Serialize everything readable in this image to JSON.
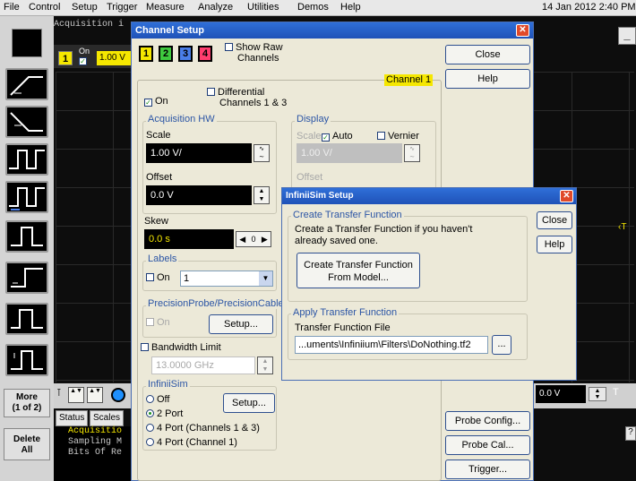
{
  "menubar": {
    "items": [
      "File",
      "Control",
      "Setup",
      "Trigger",
      "Measure",
      "Analyze",
      "Utilities",
      "Demos",
      "Help"
    ],
    "datetime": "14 Jan 2012 2:40 PM"
  },
  "left_panel": {
    "more_label": "More",
    "more_sub": "(1 of 2)",
    "delete_label": "Delete",
    "delete_sub": "All"
  },
  "scope": {
    "acquisition_header": "Acquisition i",
    "ch1_badge": "1",
    "ch1_on": "On",
    "ch1_scale": "1.00 V",
    "status_tab": "Status",
    "scales_tab": "Scales",
    "bottom_text": [
      "Acquisitio",
      "Sampling M",
      "",
      "Bits Of Re"
    ],
    "right_value": "0.0 V",
    "right_t": "T",
    "right_q": "?"
  },
  "channel_setup": {
    "title": "Channel Setup",
    "channels": [
      "1",
      "2",
      "3",
      "4"
    ],
    "channel_colors": [
      "#f5e700",
      "#3ec93e",
      "#4a7ee8",
      "#ff3d6e"
    ],
    "show_raw": "Show Raw",
    "show_raw_2": "Channels",
    "close": "Close",
    "help": "Help",
    "channel_label": "Channel 1",
    "on": "On",
    "differential": "Differential",
    "differential_2": "Channels 1 & 3",
    "acq_hw": "Acquisition HW",
    "scale_label": "Scale",
    "scale_value": "1.00 V/",
    "offset_label": "Offset",
    "offset_value": "0.0 V",
    "display": "Display",
    "disp_scale": "Scale",
    "auto": "Auto",
    "vernier": "Vernier",
    "disp_scale_value": "1.00 V/",
    "disp_offset": "Offset",
    "skew_label": "Skew",
    "skew_value": "0.0 s",
    "skew_step": "0",
    "labels": "Labels",
    "labels_on": "On",
    "labels_value": "1",
    "precision": "PrecisionProbe/PrecisionCable",
    "precision_on": "On",
    "setup": "Setup...",
    "bandwidth": "Bandwidth Limit",
    "bandwidth_value": "13.0000 GHz",
    "infiniisim": "InfiniiSim",
    "off": "Off",
    "two_port": "2 Port",
    "four_port_13": "4 Port  (Channels 1 & 3)",
    "four_port_1": "4 Port  (Channel 1)",
    "setup2": "Setup...",
    "probe_config": "Probe Config...",
    "probe_cal": "Probe Cal...",
    "trigger": "Trigger..."
  },
  "infiniisim_setup": {
    "title": "InfiniiSim Setup",
    "create_group": "Create Transfer Function",
    "create_text_1": "Create a Transfer Function if you haven't",
    "create_text_2": "already saved one.",
    "create_button_1": "Create Transfer Function",
    "create_button_2": "From Model...",
    "apply_group": "Apply Transfer Function",
    "file_label": "Transfer Function File",
    "file_value": "...uments\\Infiniium\\Filters\\DoNothing.tf2",
    "browse": "...",
    "close": "Close",
    "help": "Help"
  }
}
